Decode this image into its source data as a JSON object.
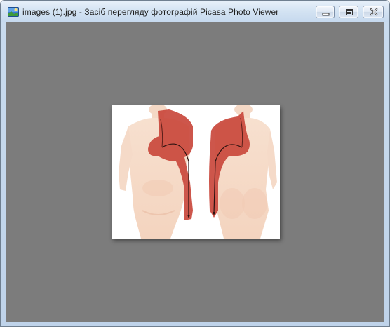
{
  "window": {
    "title": "images (1).jpg - Засіб перегляду фотографій Picasa Photo Viewer",
    "icon": "picture-icon"
  },
  "controls": {
    "minimize": "minimize-icon",
    "maximize": "maximize-icon",
    "close": "close-icon"
  },
  "colors": {
    "viewer_background": "#7c7c7c",
    "muscle_red": "#c9483c",
    "skin": "#f6dcc9"
  }
}
